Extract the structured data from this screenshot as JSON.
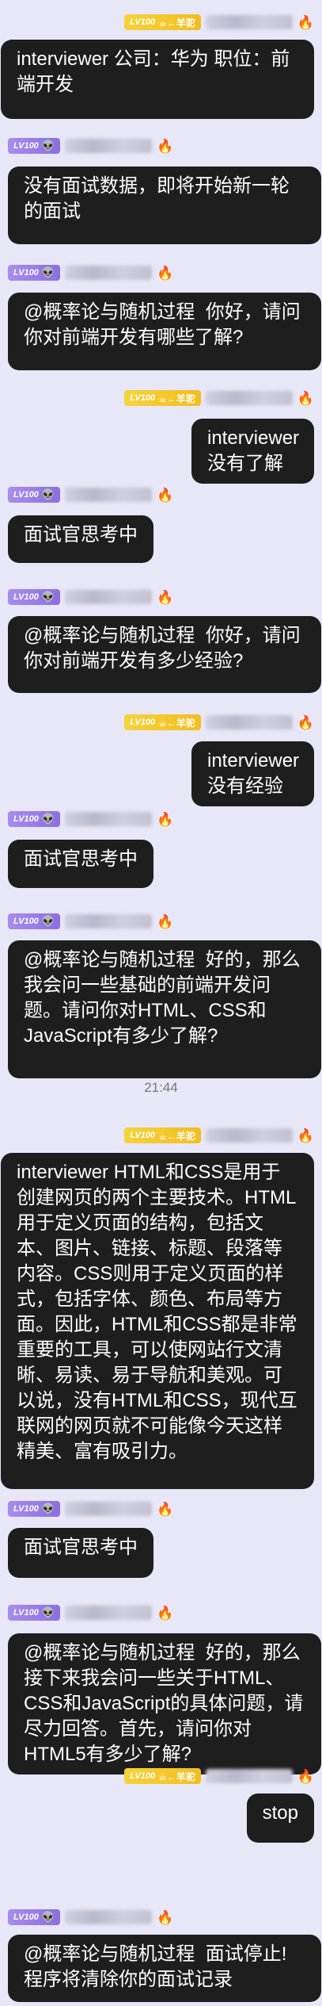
{
  "timestamp": "21:44",
  "senders": {
    "user": {
      "level": "LV100",
      "tag": "☕←羊驼",
      "emoji": "🔥"
    },
    "bot": {
      "level": "LV100",
      "emoji": "👽",
      "fire": "🔥"
    }
  },
  "messages": [
    {
      "side": "right",
      "sender": "user",
      "text": "interviewer 公司：华为 职位：前端开发"
    },
    {
      "side": "left",
      "sender": "bot",
      "text": "没有面试数据，即将开始新一轮的面试"
    },
    {
      "side": "left",
      "sender": "bot",
      "text": "@概率论与随机过程  你好，请问你对前端开发有哪些了解?"
    },
    {
      "side": "right",
      "sender": "user",
      "text": "interviewer 没有了解"
    },
    {
      "side": "left",
      "sender": "bot",
      "text": "面试官思考中"
    },
    {
      "side": "left",
      "sender": "bot",
      "text": "@概率论与随机过程  你好，请问你对前端开发有多少经验?"
    },
    {
      "side": "right",
      "sender": "user",
      "text": "interviewer 没有经验"
    },
    {
      "side": "left",
      "sender": "bot",
      "text": "面试官思考中"
    },
    {
      "side": "left",
      "sender": "bot",
      "text": "@概率论与随机过程  好的，那么我会问一些基础的前端开发问题。请问你对HTML、CSS和JavaScript有多少了解?"
    },
    {
      "side": "right",
      "sender": "user",
      "text": "interviewer HTML和CSS是用于创建网页的两个主要技术。HTML用于定义页面的结构，包括文本、图片、链接、标题、段落等内容。CSS则用于定义页面的样式，包括字体、颜色、布局等方面。因此，HTML和CSS都是非常重要的工具，可以使网站行文清晰、易读、易于导航和美观。可以说，没有HTML和CSS，现代互联网的网页就不可能像今天这样精美、富有吸引力。"
    },
    {
      "side": "left",
      "sender": "bot",
      "text": "面试官思考中"
    },
    {
      "side": "left",
      "sender": "bot",
      "text": "@概率论与随机过程  好的，那么接下来我会问一些关于HTML、CSS和JavaScript的具体问题，请尽力回答。首先，请问你对HTML5有多少了解?"
    },
    {
      "side": "right",
      "sender": "user",
      "text": "stop"
    },
    {
      "side": "left",
      "sender": "bot",
      "text": "@概率论与随机过程  面试停止! 程序将清除你的面试记录"
    }
  ]
}
